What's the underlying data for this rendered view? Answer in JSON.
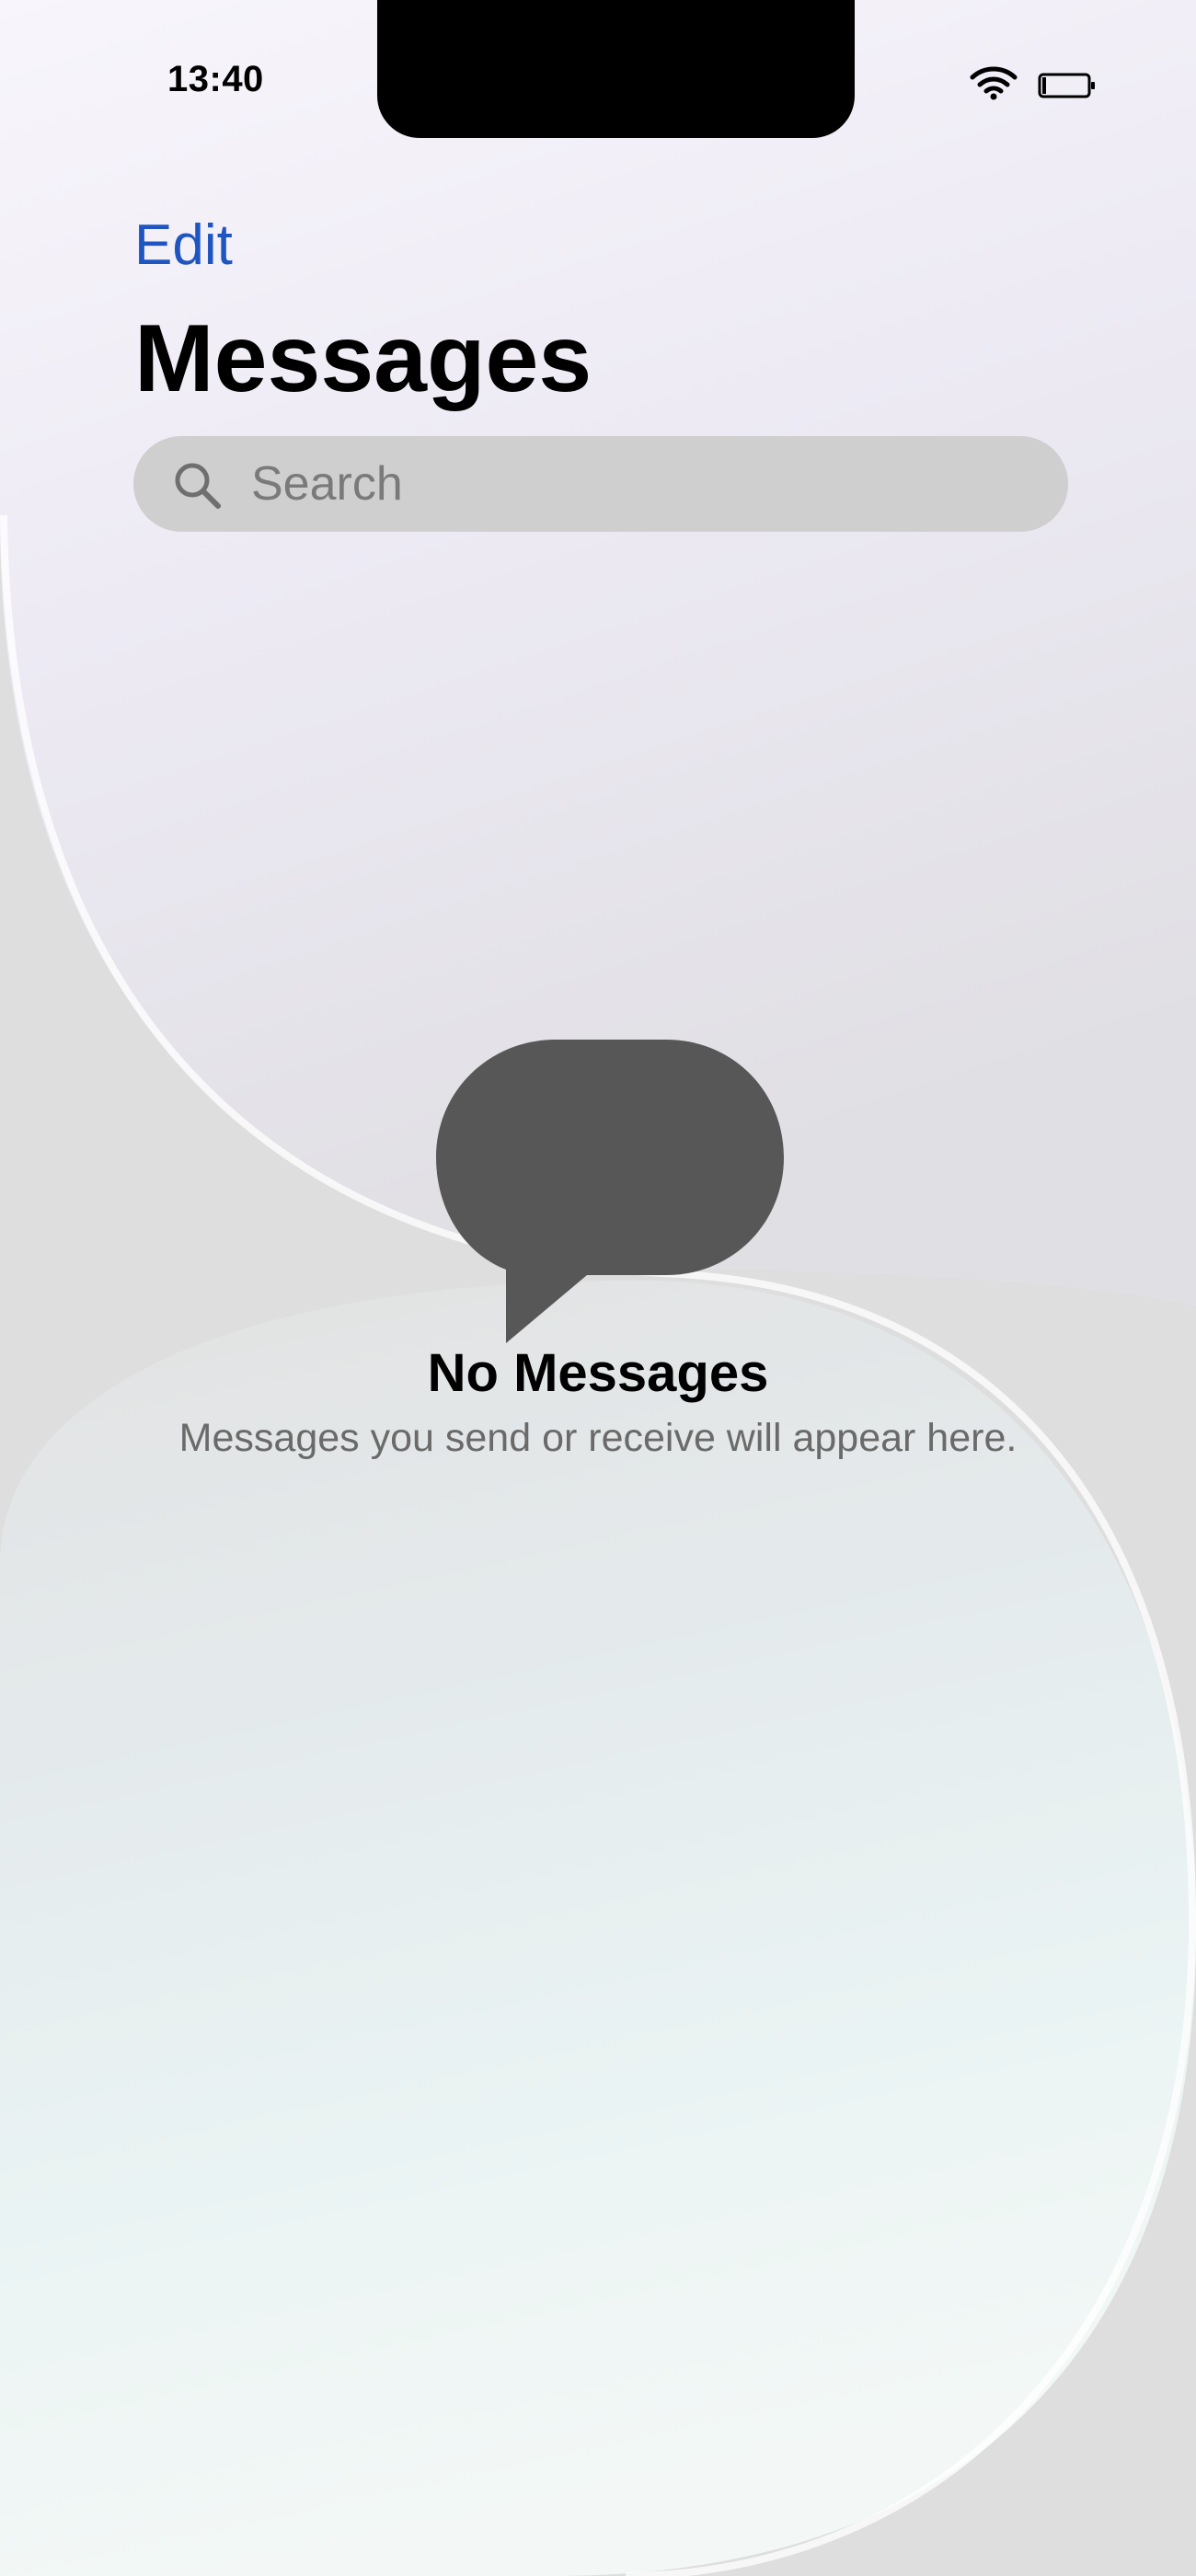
{
  "status_bar": {
    "time": "13:40",
    "wifi_icon": "wifi-icon",
    "battery_icon": "battery-icon"
  },
  "header": {
    "edit_label": "Edit",
    "title": "Messages"
  },
  "search": {
    "placeholder": "Search",
    "icon": "search-icon"
  },
  "empty_state": {
    "icon": "message-bubble-icon",
    "title": "No Messages",
    "subtitle": "Messages you send or receive will appear here."
  },
  "colors": {
    "accent": "#1f55c0",
    "search_bg": "#cfcfcf",
    "bubble": "#575757",
    "secondary_text": "#6a6a6a"
  }
}
